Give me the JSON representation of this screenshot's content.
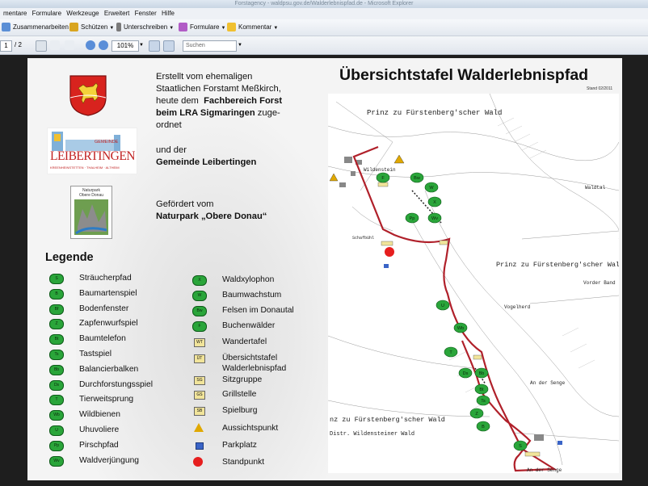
{
  "window": {
    "title": "Forstagency - waldpsu.gov.de/Walderlebnispfad.de - Microsoft Explorer"
  },
  "menu": [
    "mentare",
    "Formulare",
    "Werkzeuge",
    "Erweitert",
    "Fenster",
    "Hilfe"
  ],
  "toolbar": {
    "zusammenarbeiten": "Zusammenarbeiten",
    "schuetzen": "Schützen",
    "unterschreiben": "Unterschreiben",
    "formulare": "Formulare",
    "kommentar": "Kommentar"
  },
  "nav": {
    "page": "1",
    "of": "/ 2",
    "zoom": "101%",
    "search_placeholder": "Suchen"
  },
  "credits": {
    "line1a": "Erstellt vom ehemaligen",
    "line1b": "Staatlichen Forstamt Meßkirch,",
    "line1c_pre": "heute dem",
    "line1c_bold": "Fachbereich Forst",
    "line1d_bold": "beim LRA Sigmaringen",
    "line1d_post": "zuge-",
    "line1e": "ordnet",
    "line2a": "und der",
    "line2b": "Gemeinde Leibertingen",
    "line3a": "Gefördert vom",
    "line3b": "Naturpark „Obere Donau“"
  },
  "logos": {
    "leibertingen_top": "GEMEINDE",
    "leibertingen_main": "LEIBERTINGEN",
    "leibertingen_sub": "KREENHEINSTETTEN · THALHEIM · ALTHEIM",
    "naturpark_1": "Naturpark",
    "naturpark_2": "Obere Donau"
  },
  "legend": {
    "title": "Legende",
    "col1": [
      {
        "code": "S",
        "label": "Sträucherpfad"
      },
      {
        "code": "B",
        "label": "Baumartenspiel"
      },
      {
        "code": "Bf",
        "label": "Bodenfenster"
      },
      {
        "code": "Z",
        "label": "Zapfenwurfspiel"
      },
      {
        "code": "Bt",
        "label": "Baumtelefon"
      },
      {
        "code": "Ts",
        "label": "Tastspiel"
      },
      {
        "code": "Bb",
        "label": "Balancierbalken"
      },
      {
        "code": "Ds",
        "label": "Durchforstungsspiel"
      },
      {
        "code": "T",
        "label": "Tierweitsprung"
      },
      {
        "code": "Wb",
        "label": "Wildbienen"
      },
      {
        "code": "U",
        "label": "Uhuvoliere"
      },
      {
        "code": "Pp",
        "label": "Pirschpfad"
      },
      {
        "code": "Wv",
        "label": "Waldverjüngung"
      }
    ],
    "col2": [
      {
        "code": "X",
        "label": "Waldxylophon",
        "kind": "green"
      },
      {
        "code": "W",
        "label": "Baumwachstum",
        "kind": "green"
      },
      {
        "code": "Bw",
        "label": "Felsen im Donautal",
        "kind": "green"
      },
      {
        "code": "F",
        "label": "Buchenwälder",
        "kind": "green"
      },
      {
        "code": "WT",
        "label": "Wandertafel",
        "kind": "sign"
      },
      {
        "code": "ÜT",
        "label": "Übersichtstafel",
        "label2": "Walderlebnispfad",
        "kind": "sign"
      },
      {
        "code": "SG",
        "label": "Sitzgruppe",
        "kind": "sign"
      },
      {
        "code": "GS",
        "label": "Grillstelle",
        "kind": "sign"
      },
      {
        "code": "SB",
        "label": "Spielburg",
        "kind": "sign"
      },
      {
        "code": "",
        "label": "Aussichtspunkt",
        "kind": "triangle"
      },
      {
        "code": "",
        "label": "Parkplatz",
        "kind": "parking"
      },
      {
        "code": "",
        "label": "Standpunkt",
        "kind": "dot"
      }
    ]
  },
  "map": {
    "title": "Übersichtstafel Walderlebnispfad",
    "stand": "Stand 02/2011",
    "labels": {
      "wald1": "Prinz zu Fürstenberg'scher Wald",
      "wald2": "Prinz zu Fürstenberg'scher Wald",
      "wald3": "nz zu Fürstenberg'scher Wald",
      "distr": "Distr. Wildensteiner Wald",
      "waldtal": "Waldtal",
      "vorder": "Vorder Band",
      "vogelherd": "Vogelherd",
      "senge1": "An der Senge",
      "senge2": "An der Senge",
      "wildenstein": "Wildenstein",
      "schafbuehl": "Schafbühl"
    },
    "stations": [
      "F",
      "Bw",
      "W",
      "X",
      "Wv",
      "Pp",
      "U",
      "Wb",
      "T",
      "Ds",
      "Bb",
      "Bt",
      "Ts",
      "Z",
      "B",
      "S"
    ],
    "colors": {
      "route": "#b0202a",
      "station": "#2aa53a",
      "dot": "#e61e1e"
    }
  }
}
